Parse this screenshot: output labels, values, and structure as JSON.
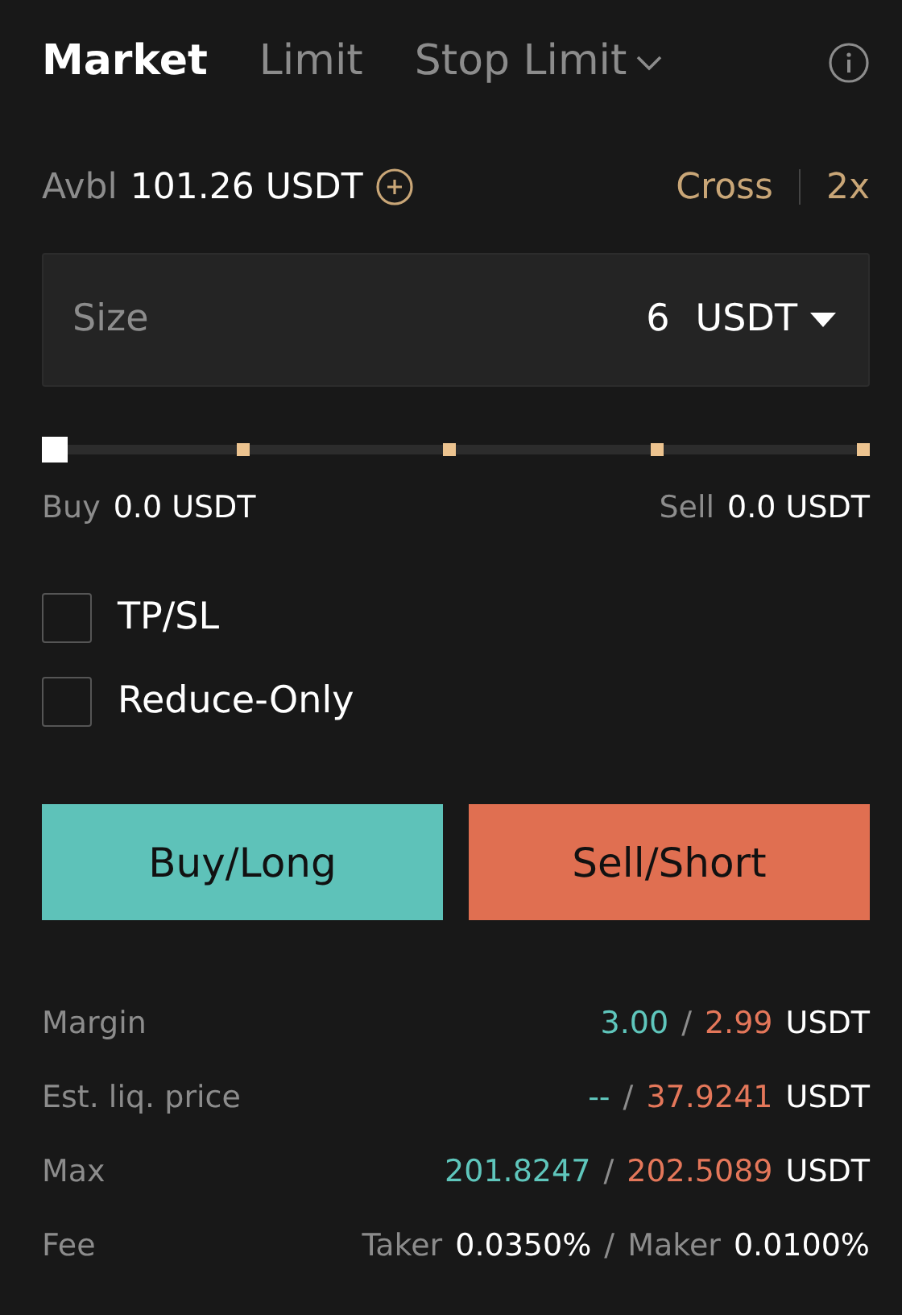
{
  "tabs": [
    {
      "label": "Market",
      "selected": true,
      "dropdown": false
    },
    {
      "label": "Limit",
      "selected": false,
      "dropdown": false
    },
    {
      "label": "Stop Limit",
      "selected": false,
      "dropdown": true
    }
  ],
  "available": {
    "label": "Avbl",
    "value": "101.26 USDT"
  },
  "margin_mode": "Cross",
  "leverage": "2x",
  "size": {
    "label": "Size",
    "value": "6",
    "unit": "USDT"
  },
  "slider": {
    "level": 0
  },
  "slider_readings": [
    {
      "label": "Buy",
      "value": "0.0 USDT"
    },
    {
      "label": "Sell",
      "value": "0.0 USDT"
    }
  ],
  "options": [
    {
      "label": "TP/SL",
      "checked": false
    },
    {
      "label": "Reduce-Only",
      "checked": false
    }
  ],
  "buttons": [
    {
      "label": "Buy/Long",
      "kind": "buy"
    },
    {
      "label": "Sell/Short",
      "kind": "sell"
    }
  ],
  "summary": [
    {
      "label": "Margin",
      "parts": [
        {
          "text": "3.00",
          "kind": "buy"
        },
        {
          "text": "/",
          "kind": "separator"
        },
        {
          "text": "2.99",
          "kind": "sell"
        },
        {
          "text": "USDT",
          "kind": "plain"
        }
      ]
    },
    {
      "label": "Est. liq. price",
      "parts": [
        {
          "text": "--",
          "kind": "buy"
        },
        {
          "text": "/",
          "kind": "separator"
        },
        {
          "text": "37.9241",
          "kind": "sell"
        },
        {
          "text": "USDT",
          "kind": "plain"
        }
      ]
    },
    {
      "label": "Max",
      "parts": [
        {
          "text": "201.8247",
          "kind": "buy"
        },
        {
          "text": "/",
          "kind": "separator"
        },
        {
          "text": "202.5089",
          "kind": "sell"
        },
        {
          "text": "USDT",
          "kind": "plain"
        }
      ]
    },
    {
      "label": "Fee",
      "parts": [
        {
          "text": "Taker",
          "kind": "muted"
        },
        {
          "text": "0.0350%",
          "kind": "plain"
        },
        {
          "text": "/",
          "kind": "separator"
        },
        {
          "text": "Maker",
          "kind": "muted"
        },
        {
          "text": "0.0100%",
          "kind": "plain"
        }
      ]
    }
  ]
}
